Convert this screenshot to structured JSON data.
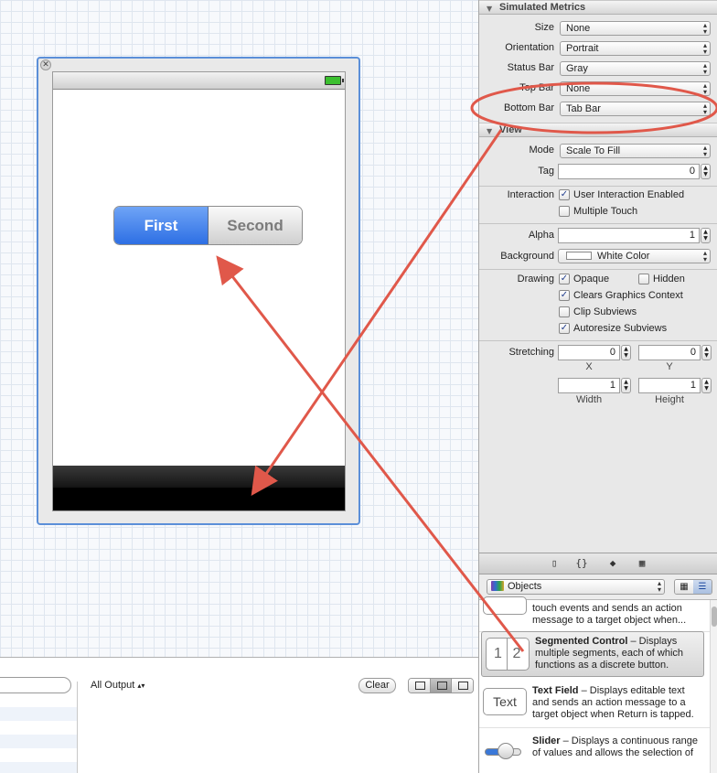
{
  "canvas": {
    "segmented": {
      "first": "First",
      "second": "Second"
    }
  },
  "console": {
    "filter_label": "All Output",
    "clear_label": "Clear"
  },
  "inspector": {
    "simulated_metrics": {
      "header": "Simulated Metrics",
      "rows": [
        {
          "label": "Size",
          "value": "None"
        },
        {
          "label": "Orientation",
          "value": "Portrait"
        },
        {
          "label": "Status Bar",
          "value": "Gray"
        },
        {
          "label": "Top Bar",
          "value": "None"
        },
        {
          "label": "Bottom Bar",
          "value": "Tab Bar"
        }
      ]
    },
    "view": {
      "header": "View",
      "mode_label": "Mode",
      "mode_value": "Scale To Fill",
      "tag_label": "Tag",
      "tag_value": "0",
      "interaction_label": "Interaction",
      "user_interaction": "User Interaction Enabled",
      "multiple_touch": "Multiple Touch",
      "alpha_label": "Alpha",
      "alpha_value": "1",
      "background_label": "Background",
      "background_value": "White Color",
      "drawing_label": "Drawing",
      "opaque": "Opaque",
      "hidden": "Hidden",
      "clears_context": "Clears Graphics Context",
      "clip_subviews": "Clip Subviews",
      "autoresize": "Autoresize Subviews",
      "stretching_label": "Stretching",
      "stretch_x": "0",
      "stretch_y": "0",
      "stretch_w": "1",
      "stretch_h": "1",
      "x_label": "X",
      "y_label": "Y",
      "width_label": "Width",
      "height_label": "Height"
    }
  },
  "library": {
    "filter_value": "Objects",
    "items": [
      {
        "name": "",
        "desc": "touch events and sends an action message to a target object when..."
      },
      {
        "name": "Segmented Control",
        "desc": " – Displays multiple segments, each of which functions as a discrete button.",
        "thumb": "1|2"
      },
      {
        "name": "Text Field",
        "desc": " – Displays editable text and sends an action message to a target object when Return is tapped.",
        "thumb": "Text"
      },
      {
        "name": "Slider",
        "desc": " – Displays a continuous range of values and allows the selection of"
      }
    ]
  },
  "colors": {
    "annotation": "#e0584a",
    "selection": "#5b8fd8",
    "segment_selected": "#2d6fe4"
  }
}
